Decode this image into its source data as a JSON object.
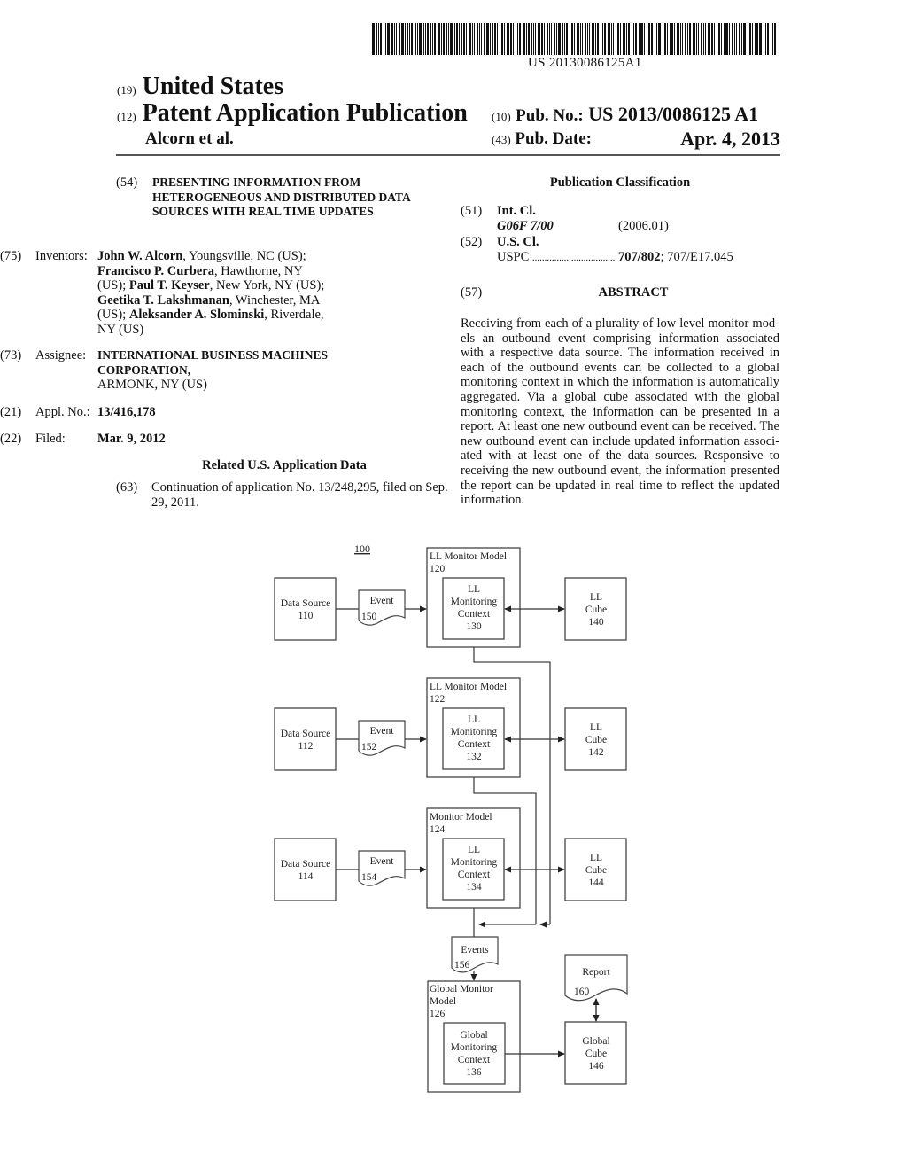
{
  "header": {
    "barcode_text": "US 20130086125A1",
    "country_code": "(19)",
    "country": "United States",
    "pubtype_code": "(12)",
    "pubtype": "Patent Application Publication",
    "inventor_short": "Alcorn et al.",
    "pubno_code": "(10)",
    "pubno_label": "Pub. No.:",
    "pubno_value": "US 2013/0086125 A1",
    "pubdate_code": "(43)",
    "pubdate_label": "Pub. Date:",
    "pubdate_value": "Apr. 4, 2013"
  },
  "left": {
    "title": {
      "code": "(54)",
      "text": "PRESENTING INFORMATION FROM HETEROGENEOUS AND DISTRIBUTED DATA SOURCES WITH REAL TIME UPDATES"
    },
    "inventors": {
      "code": "(75)",
      "label": "Inventors:",
      "people": [
        {
          "name": "John W. Alcorn",
          "place": ", Youngsville, NC (US);"
        },
        {
          "name": "Francisco P. Curbera",
          "place": ", Hawthorne, NY (US);"
        },
        {
          "name": "Paul T. Keyser",
          "place": ", New York, NY (US);"
        },
        {
          "name": "Geetika T. Lakshmanan",
          "place": ", Winchester, MA (US);"
        },
        {
          "name": "Aleksander A. Slominski",
          "place": ", Riverdale, NY (US)"
        }
      ]
    },
    "assignee": {
      "code": "(73)",
      "label": "Assignee:",
      "name": "INTERNATIONAL BUSINESS MACHINES CORPORATION,",
      "place": "ARMONK, NY (US)"
    },
    "appl": {
      "code": "(21)",
      "label": "Appl. No.:",
      "value": "13/416,178"
    },
    "filed": {
      "code": "(22)",
      "label": "Filed:",
      "value": "Mar. 9, 2012"
    },
    "related_title": "Related U.S. Application Data",
    "continuation": {
      "code": "(63)",
      "text": "Continuation of application No. 13/248,295, filed on Sep. 29, 2011."
    }
  },
  "right": {
    "classification_title": "Publication Classification",
    "intcl": {
      "code": "(51)",
      "label": "Int. Cl.",
      "class": "G06F 7/00",
      "version": "(2006.01)"
    },
    "uscl": {
      "code": "(52)",
      "label": "U.S. Cl.",
      "prefix": "USPC",
      "dots": "..................................",
      "primary": "707/802",
      "secondary": "; 707/E17.045"
    },
    "abstract_code": "(57)",
    "abstract_title": "ABSTRACT",
    "abstract": "Receiving from each of a plurality of low level monitor mod-els an outbound event comprising information associated with a respective data source. The information received in each of the outbound events can be collected to a global monitoring context in which the information is automatically aggregated. Via a global cube associated with the global monitoring context, the information can be presented in a report. At least one new outbound event can be received. The new outbound event can include updated information associ-ated with at least one of the data sources. Responsive to receiving the new outbound event, the information presented the report can be updated in real time to reflect the updated information."
  },
  "diagram": {
    "figure_ref": "100",
    "rows": [
      {
        "source": [
          "Data Source",
          "110"
        ],
        "event": [
          "Event",
          "150"
        ],
        "model": [
          "LL Monitor Model",
          "120"
        ],
        "context": [
          "LL",
          "Monitoring",
          "Context",
          "130"
        ],
        "cube": [
          "LL",
          "Cube",
          "140"
        ]
      },
      {
        "source": [
          "Data Source",
          "112"
        ],
        "event": [
          "Event",
          "152"
        ],
        "model": [
          "LL Monitor Model",
          "122"
        ],
        "context": [
          "LL",
          "Monitoring",
          "Context",
          "132"
        ],
        "cube": [
          "LL",
          "Cube",
          "142"
        ]
      },
      {
        "source": [
          "Data Source",
          "114"
        ],
        "event": [
          "Event",
          "154"
        ],
        "model": [
          "Monitor Model",
          "124"
        ],
        "context": [
          "LL",
          "Monitoring",
          "Context",
          "134"
        ],
        "cube": [
          "LL",
          "Cube",
          "144"
        ]
      }
    ],
    "events": [
      "Events",
      "156"
    ],
    "global_model": [
      "Global Monitor",
      "Model",
      "126"
    ],
    "global_context": [
      "Global",
      "Monitoring",
      "Context",
      "136"
    ],
    "report": [
      "Report",
      "160"
    ],
    "global_cube": [
      "Global",
      "Cube",
      "146"
    ]
  }
}
